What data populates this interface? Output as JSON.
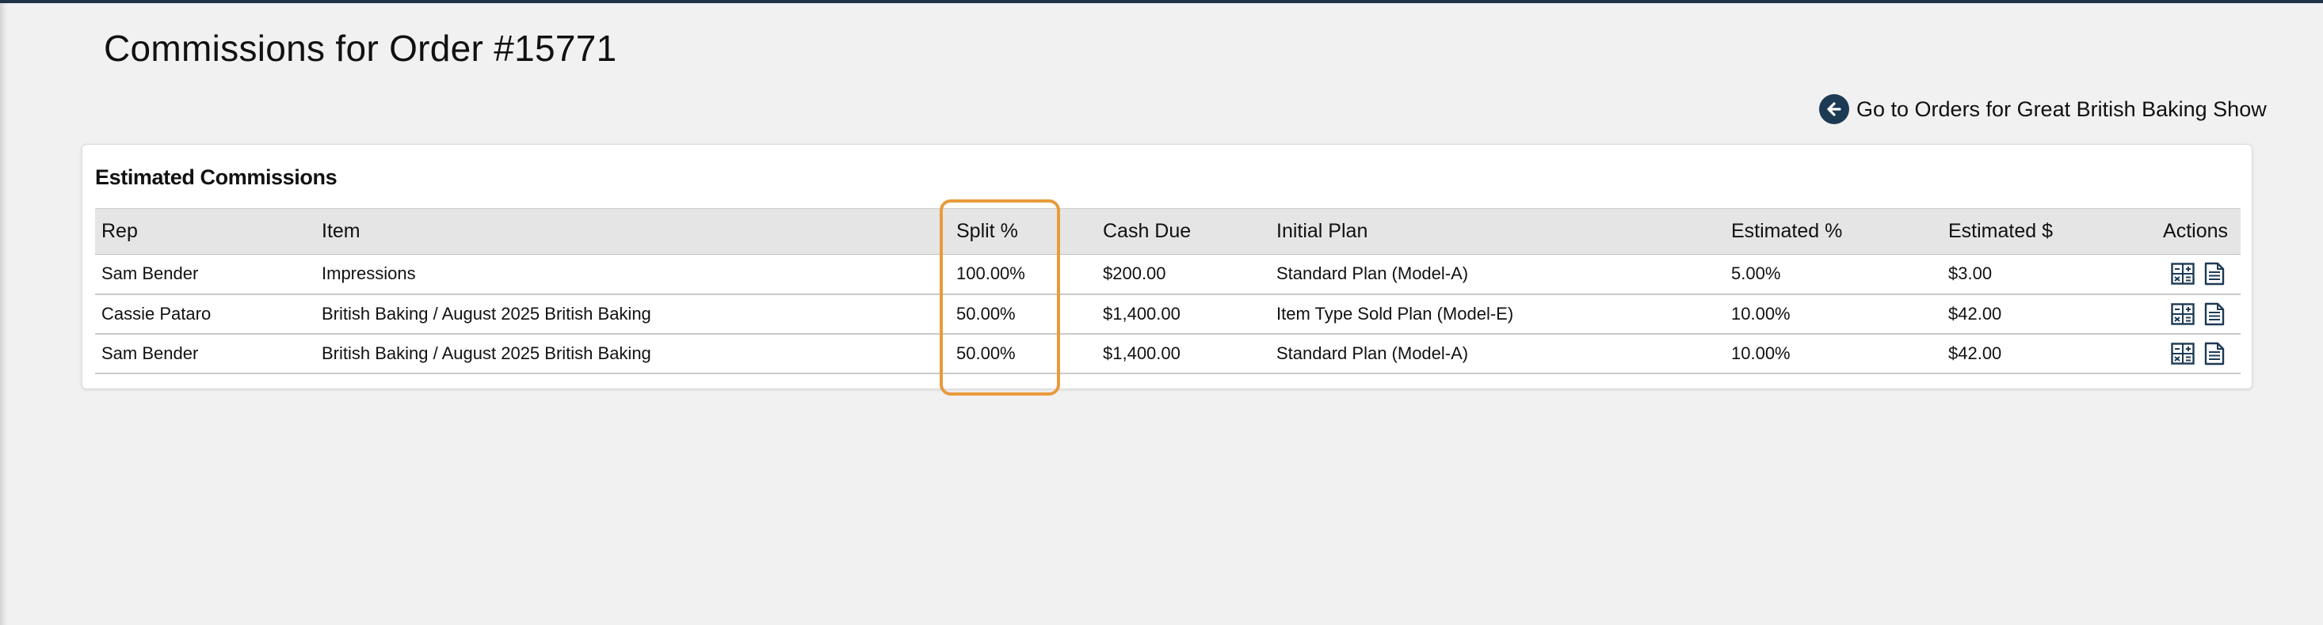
{
  "page": {
    "title": "Commissions for Order #15771"
  },
  "back_link": {
    "label": "Go to Orders for Great British Baking Show",
    "icon": "arrow-left-circle-icon"
  },
  "card": {
    "title": "Estimated Commissions"
  },
  "table": {
    "columns": [
      "Rep",
      "Item",
      "Split %",
      "Cash Due",
      "Initial Plan",
      "Estimated %",
      "Estimated $",
      "Actions"
    ],
    "rows": [
      {
        "rep": "Sam Bender",
        "item": "Impressions",
        "split": "100.00%",
        "cash_due": "$200.00",
        "initial_plan": "Standard Plan (Model-A)",
        "estimated_pct": "5.00%",
        "estimated_amt": "$3.00"
      },
      {
        "rep": "Cassie Pataro",
        "item": "British Baking / August 2025 British Baking",
        "split": "50.00%",
        "cash_due": "$1,400.00",
        "initial_plan": "Item Type Sold Plan (Model-E)",
        "estimated_pct": "10.00%",
        "estimated_amt": "$42.00"
      },
      {
        "rep": "Sam Bender",
        "item": "British Baking / August 2025 British Baking",
        "split": "50.00%",
        "cash_due": "$1,400.00",
        "initial_plan": "Standard Plan (Model-A)",
        "estimated_pct": "10.00%",
        "estimated_amt": "$42.00"
      }
    ],
    "action_icons": [
      "calculator-icon",
      "document-icon"
    ]
  },
  "theme": {
    "accent_navy": "#1d3a54",
    "highlight_orange": "#e89a3c"
  }
}
